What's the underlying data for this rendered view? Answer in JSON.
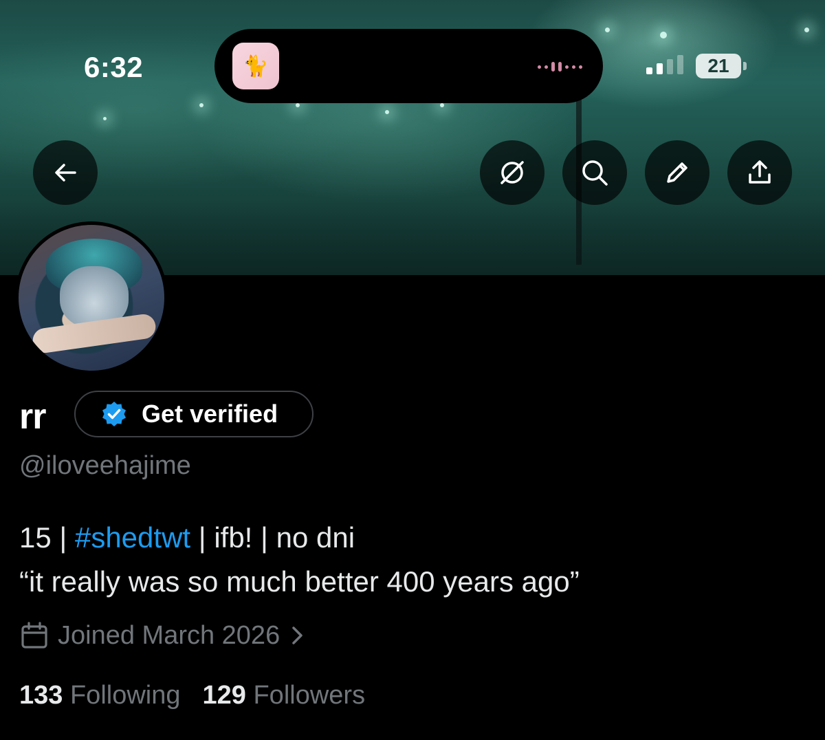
{
  "status_bar": {
    "time": "6:32",
    "battery": "21",
    "now_playing_icon": "cat-sticker-icon"
  },
  "header": {
    "back_icon": "arrow-left-icon",
    "actions": [
      {
        "name": "grok-icon"
      },
      {
        "name": "search-icon"
      },
      {
        "name": "edit-pencil-icon"
      },
      {
        "name": "share-icon"
      }
    ]
  },
  "profile": {
    "display_name": "rr",
    "verify_label": "Get verified",
    "handle": "@iloveehajime",
    "bio_prefix": "15 | ",
    "bio_hashtag": "#shedtwt",
    "bio_suffix": " | ifb! | no dni",
    "bio_quote": "“it really was so much better 400 years ago”",
    "joined": "Joined March 2026",
    "following_count": "133",
    "following_label": "Following",
    "followers_count": "129",
    "followers_label": "Followers"
  },
  "colors": {
    "accent": "#1d9bf0",
    "muted": "#71767b",
    "background": "#000000"
  }
}
